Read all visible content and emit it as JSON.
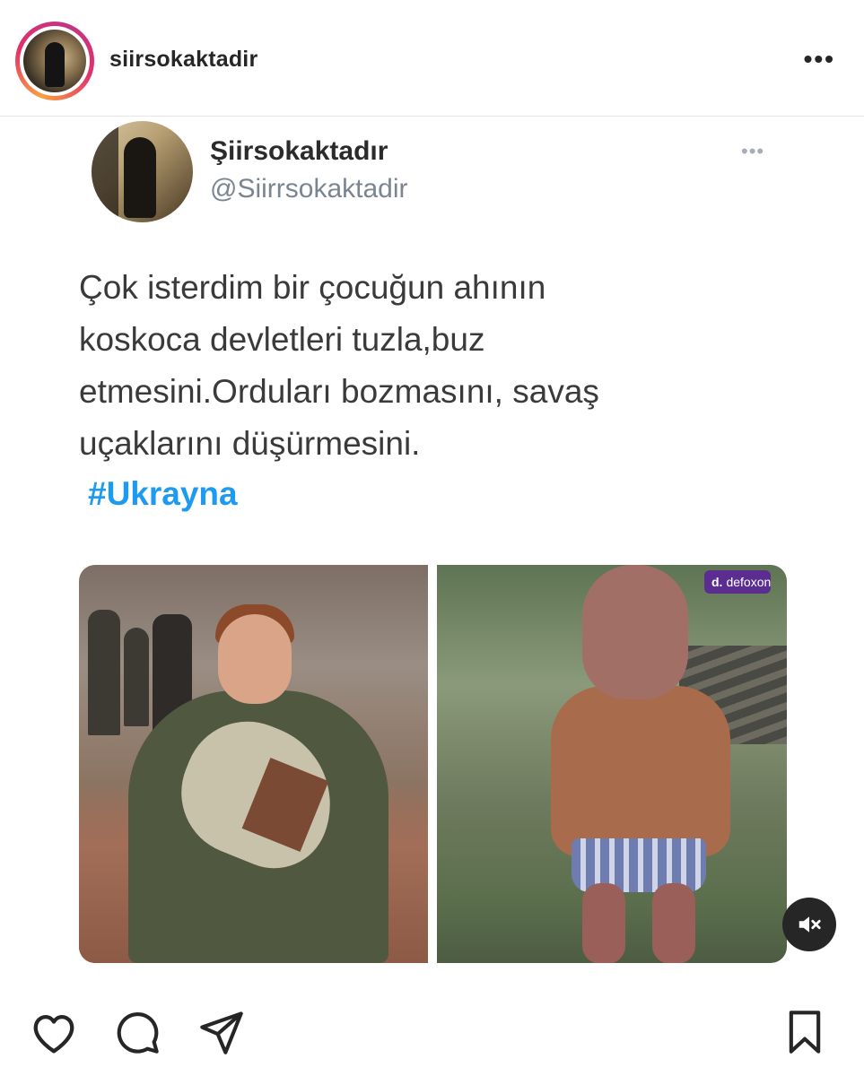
{
  "post": {
    "username": "siirsokaktadir",
    "more_label": "•••"
  },
  "tweet": {
    "display_name": "Şiirsokaktadır",
    "handle": "@Siirrsokaktadir",
    "more_label": "•••",
    "text_lines": [
      "Çok isterdim bir çocuğun ahının",
      "koskoca devletleri tuzla,buz",
      "etmesini.Orduları bozmasını, savaş",
      "uçaklarını düşürmesini."
    ],
    "hashtag": "#Ukrayna"
  },
  "media": {
    "badge_text": "defoxon",
    "badge_logo": "d.",
    "badge_color": "#5b2d91",
    "mute_icon": "muted-speaker-icon"
  },
  "actions": {
    "icons": [
      "heart-icon",
      "comment-icon",
      "share-icon",
      "bookmark-icon"
    ]
  },
  "colors": {
    "hashtag": "#1d9bf0",
    "handle": "#7b8590",
    "story_ring": [
      "#f9a03f",
      "#e1306c",
      "#c13584"
    ]
  }
}
